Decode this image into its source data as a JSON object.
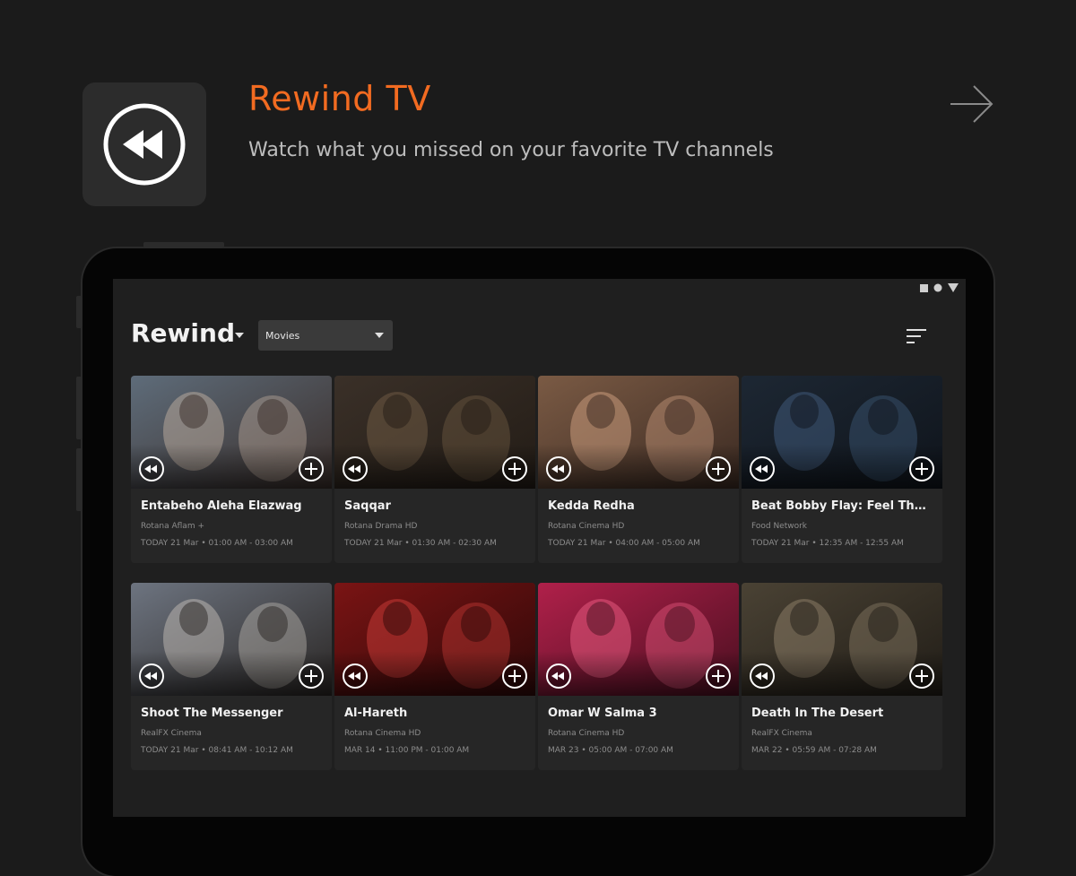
{
  "promo": {
    "icon": "rewind-circle-icon",
    "title": "Rewind TV",
    "subtitle": "Watch what you missed on your favorite TV channels",
    "next_icon": "arrow-right-icon"
  },
  "status_bar": {
    "icons": [
      "stop-square-icon",
      "record-dot-icon",
      "triangle-down-icon"
    ]
  },
  "app": {
    "title": "Rewind",
    "title_icon": "caret-down-icon",
    "genre_selected": "Movies",
    "sort_icon": "sort-lines-icon"
  },
  "cards": [
    {
      "title": "Entabeho Aleha Elazwag",
      "channel": "Rotana Aflam +",
      "time": "TODAY 21 Mar  •  01:00 AM - 03:00 AM",
      "palette": [
        "#5e6c7a",
        "#b7a79a",
        "#3a2e2a"
      ]
    },
    {
      "title": "Saqqar",
      "channel": "Rotana Drama HD",
      "time": "TODAY 21 Mar  •  01:30 AM - 02:30 AM",
      "palette": [
        "#3a3028",
        "#6e5a43",
        "#231c16"
      ]
    },
    {
      "title": "Kedda Redha",
      "channel": "Rotana Cinema HD",
      "time": "TODAY 21 Mar  •  04:00 AM - 05:00 AM",
      "palette": [
        "#7a5a44",
        "#c89a7c",
        "#3b2a22"
      ]
    },
    {
      "title": "Beat Bobby Flay: Feel The Heat",
      "channel": "Food Network",
      "time": "TODAY 21 Mar  •  12:35 AM - 12:55 AM",
      "palette": [
        "#1d2733",
        "#3f5a7a",
        "#0f141b"
      ]
    },
    {
      "title": "Shoot The Messenger",
      "channel": "RealFX Cinema",
      "time": "TODAY 21 Mar  •  08:41 AM - 10:12 AM",
      "palette": [
        "#6d7480",
        "#b9b4ae",
        "#2a2624"
      ]
    },
    {
      "title": "Al-Hareth",
      "channel": "Rotana Cinema HD",
      "time": "MAR 14  •  11:00 PM - 01:00 AM",
      "palette": [
        "#7a1414",
        "#c43a36",
        "#2e0808"
      ]
    },
    {
      "title": "Omar W Salma 3",
      "channel": "Rotana Cinema HD",
      "time": "MAR 23  •  05:00 AM - 07:00 AM",
      "palette": [
        "#b0204a",
        "#e4597e",
        "#4a0f20"
      ]
    },
    {
      "title": "Death In The Desert",
      "channel": "RealFX Cinema",
      "time": "MAR 22  •  05:59 AM - 07:28 AM",
      "palette": [
        "#4a4234",
        "#8a7c66",
        "#211d17"
      ]
    }
  ],
  "colors": {
    "accent": "#f26b21",
    "background": "#1b1b1b",
    "card": "#262626"
  }
}
